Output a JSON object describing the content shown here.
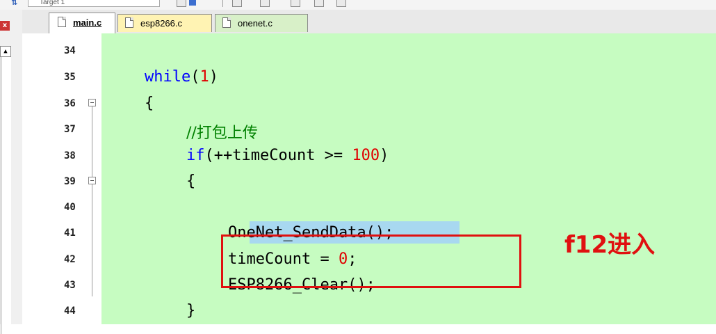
{
  "toolbar": {
    "target_label": "Target 1",
    "build_icon": "build-icon"
  },
  "tabs": [
    {
      "label": "main.c",
      "active": true,
      "color": "#ffffff"
    },
    {
      "label": "esp8266.c",
      "active": false,
      "color": "#fff3b3"
    },
    {
      "label": "onenet.c",
      "active": false,
      "color": "#d8f0c8"
    }
  ],
  "editor": {
    "background": "#c6fcc1",
    "lines": [
      {
        "num": "34",
        "text": ""
      },
      {
        "num": "35",
        "text": "while(1)"
      },
      {
        "num": "36",
        "text": "{"
      },
      {
        "num": "37",
        "text": "//打包上传"
      },
      {
        "num": "38",
        "text": "if(++timeCount >= 100)"
      },
      {
        "num": "39",
        "text": "{"
      },
      {
        "num": "40",
        "text": ""
      },
      {
        "num": "41",
        "text": "OneNet_SendData();"
      },
      {
        "num": "42",
        "text": "timeCount = 0;"
      },
      {
        "num": "43",
        "text": "ESP8266_Clear();"
      },
      {
        "num": "44",
        "text": "}"
      }
    ],
    "selected_text": "OneNet_SendData();"
  },
  "annotation": {
    "text": "f12进入",
    "color": "#e01010"
  }
}
